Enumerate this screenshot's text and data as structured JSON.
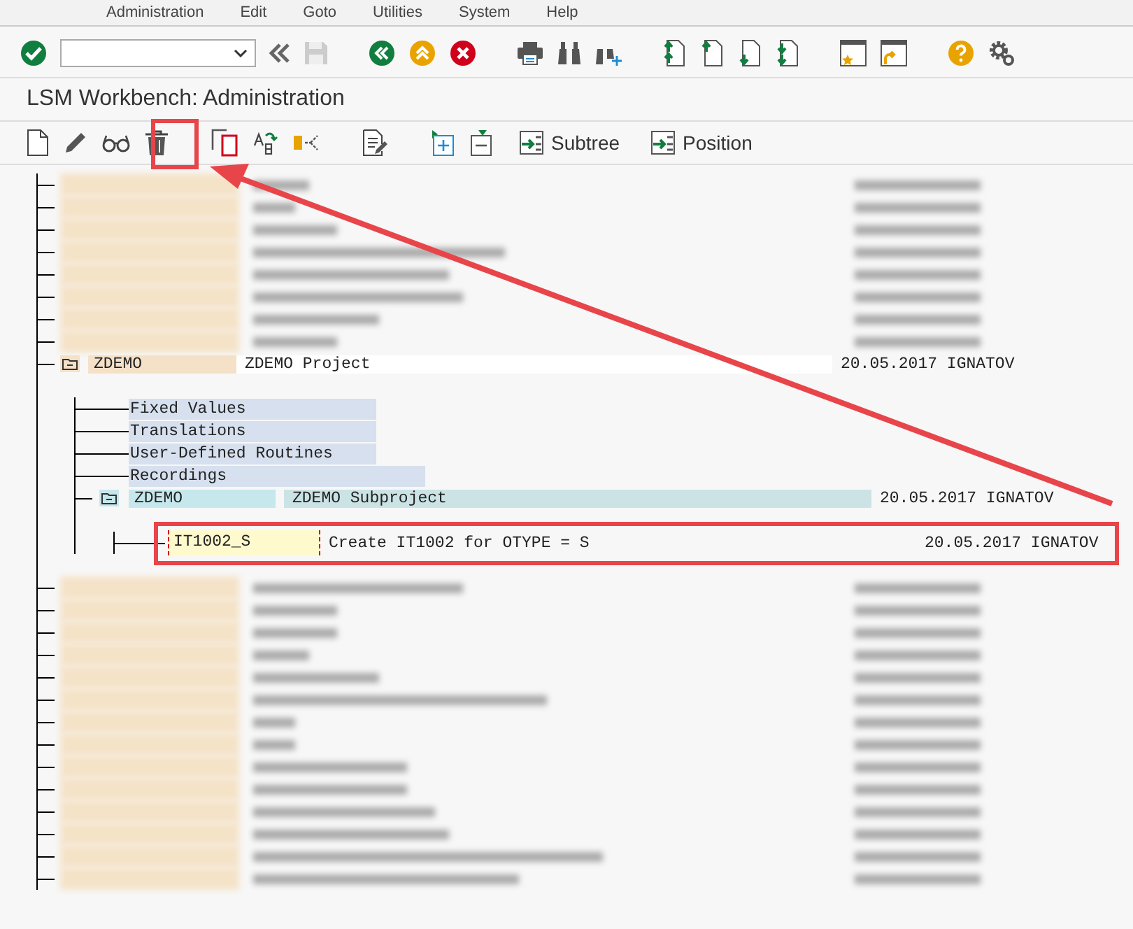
{
  "menu": [
    {
      "label": "Administration"
    },
    {
      "label": "Edit"
    },
    {
      "label": "Goto"
    },
    {
      "label": "Utilities"
    },
    {
      "label": "System"
    },
    {
      "label": "Help"
    }
  ],
  "window": {
    "title": "LSM Workbench: Administration"
  },
  "app_toolbar": {
    "buttons": [
      {
        "label": "Subtree"
      },
      {
        "label": "Position"
      }
    ]
  },
  "tree": {
    "project": {
      "name": "ZDEMO",
      "description": "ZDEMO Project",
      "date_user": "20.05.2017 IGNATOV",
      "expanded": true,
      "children": [
        {
          "kind": "setting",
          "label": "Fixed Values"
        },
        {
          "kind": "setting",
          "label": "Translations"
        },
        {
          "kind": "setting",
          "label": "User-Defined Routines"
        },
        {
          "kind": "setting",
          "label": "Recordings"
        },
        {
          "kind": "subproject",
          "name": "ZDEMO",
          "description": "ZDEMO Subproject",
          "date_user": "20.05.2017 IGNATOV",
          "expanded": true,
          "children": [
            {
              "kind": "object",
              "name": "IT1002_S",
              "description": "Create IT1002 for OTYPE = S",
              "date_user": "20.05.2017 IGNATOV",
              "selected": true
            }
          ]
        }
      ]
    }
  }
}
